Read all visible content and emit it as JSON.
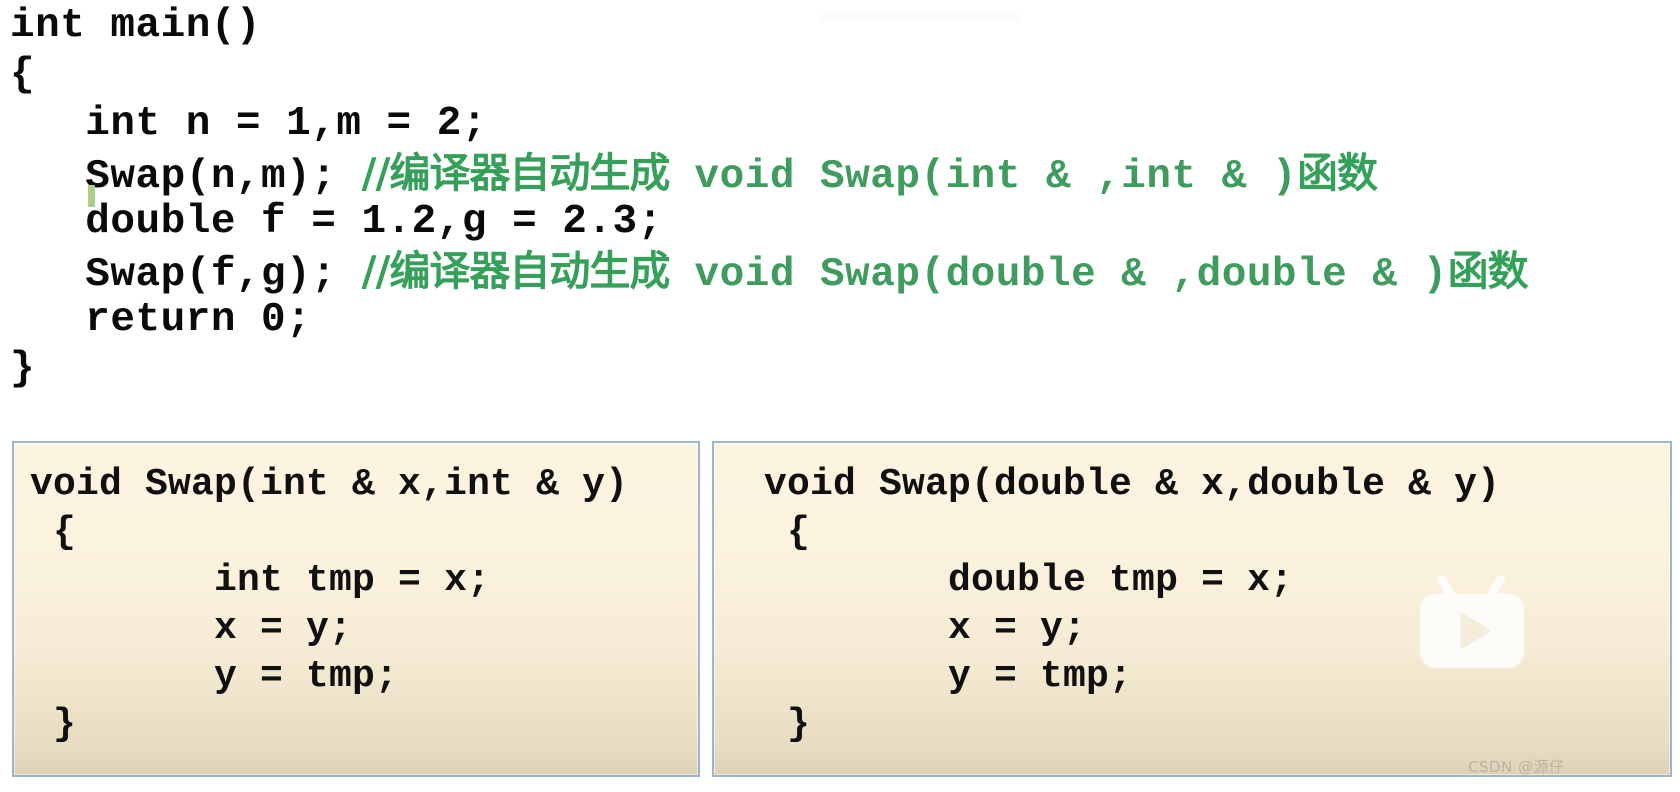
{
  "slide": {
    "main_code": {
      "lines": [
        {
          "segments": [
            {
              "text": "int main()",
              "kind": "code"
            }
          ]
        },
        {
          "segments": [
            {
              "text": "{",
              "kind": "code"
            }
          ]
        },
        {
          "segments": [
            {
              "text": "   int n = 1,m = 2;",
              "kind": "code"
            }
          ]
        },
        {
          "segments": [
            {
              "text": "   Swap(n,m); ",
              "kind": "code"
            },
            {
              "text": "//编译器自动生成",
              "kind": "comment-cn"
            },
            {
              "text": " void Swap(int & ,int & )",
              "kind": "comment"
            },
            {
              "text": "函数",
              "kind": "comment-cn"
            }
          ]
        },
        {
          "segments": [
            {
              "text": "   double f = 1.2,g = 2.3;",
              "kind": "code"
            }
          ]
        },
        {
          "segments": [
            {
              "text": "   Swap(f,g); ",
              "kind": "code"
            },
            {
              "text": "//编译器自动生成",
              "kind": "comment-cn"
            },
            {
              "text": " void Swap(double & ,double & )",
              "kind": "comment"
            },
            {
              "text": "函数",
              "kind": "comment-cn"
            }
          ]
        },
        {
          "segments": [
            {
              "text": "   return 0;",
              "kind": "code"
            }
          ]
        },
        {
          "segments": [
            {
              "text": "}",
              "kind": "code"
            }
          ]
        }
      ]
    },
    "left_box": {
      "title": "int-swap-instantiation",
      "lines": [
        "void Swap(int & x,int & y)",
        " {",
        "        int tmp = x;",
        "        x = y;",
        "        y = tmp;",
        " }"
      ]
    },
    "right_box": {
      "title": "double-swap-instantiation",
      "lines": [
        "void Swap(double & x,double & y)",
        " {",
        "        double tmp = x;",
        "        x = y;",
        "        y = tmp;",
        " }"
      ]
    },
    "watermarks": {
      "csdn": "CSDN @源仔",
      "video_logo": "bilibili-tv-logo"
    },
    "colors": {
      "code_text": "#0a0a0a",
      "comment_green": "#35a05a",
      "box_border": "#9fb4cd",
      "box_bg_top": "#fdf4e0",
      "box_bg_bottom": "#ddd2b6",
      "caret_green": "#a8cf8e",
      "page_background": "#ffffff"
    }
  }
}
